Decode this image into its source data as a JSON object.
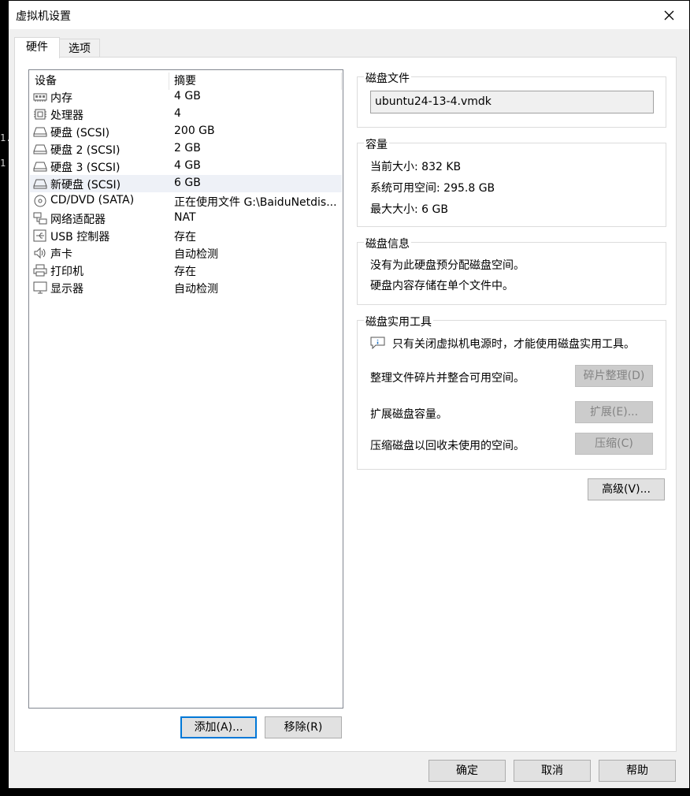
{
  "window": {
    "title": "虚拟机设置"
  },
  "tabs": [
    {
      "label": "硬件"
    },
    {
      "label": "选项"
    }
  ],
  "background_fragments": [
    "1.",
    "1"
  ],
  "device_list": {
    "columns": {
      "device": "设备",
      "summary": "摘要"
    },
    "rows": [
      {
        "icon": "memory-icon",
        "name": "内存",
        "summary": "4 GB"
      },
      {
        "icon": "cpu-icon",
        "name": "处理器",
        "summary": "4"
      },
      {
        "icon": "harddisk-icon",
        "name": "硬盘 (SCSI)",
        "summary": "200 GB"
      },
      {
        "icon": "harddisk-icon",
        "name": "硬盘 2 (SCSI)",
        "summary": "2 GB"
      },
      {
        "icon": "harddisk-icon",
        "name": "硬盘 3 (SCSI)",
        "summary": "4 GB"
      },
      {
        "icon": "harddisk-icon",
        "name": "新硬盘 (SCSI)",
        "summary": "6 GB",
        "selected": true
      },
      {
        "icon": "cd-icon",
        "name": "CD/DVD (SATA)",
        "summary": "正在使用文件 G:\\BaiduNetdis..."
      },
      {
        "icon": "network-icon",
        "name": "网络适配器",
        "summary": "NAT"
      },
      {
        "icon": "usb-icon",
        "name": "USB 控制器",
        "summary": "存在"
      },
      {
        "icon": "speaker-icon",
        "name": "声卡",
        "summary": "自动检测"
      },
      {
        "icon": "printer-icon",
        "name": "打印机",
        "summary": "存在"
      },
      {
        "icon": "monitor-icon",
        "name": "显示器",
        "summary": "自动检测"
      }
    ],
    "add_button": "添加(A)...",
    "remove_button": "移除(R)"
  },
  "disk_file": {
    "title": "磁盘文件",
    "value": "ubuntu24-13-4.vmdk"
  },
  "capacity": {
    "title": "容量",
    "current_size": "当前大小: 832 KB",
    "system_free": "系统可用空间: 295.8 GB",
    "max_size": "最大大小: 6 GB"
  },
  "disk_info": {
    "title": "磁盘信息",
    "line1": "没有为此硬盘预分配磁盘空间。",
    "line2": "硬盘内容存储在单个文件中。"
  },
  "disk_utilities": {
    "title": "磁盘实用工具",
    "notice": "只有关闭虚拟机电源时，才能使用磁盘实用工具。",
    "defrag_text": "整理文件碎片并整合可用空间。",
    "defrag_button": "碎片整理(D)",
    "expand_text": "扩展磁盘容量。",
    "expand_button": "扩展(E)...",
    "compact_text": "压缩磁盘以回收未使用的空间。",
    "compact_button": "压缩(C)"
  },
  "advanced_button": "高级(V)...",
  "footer": {
    "ok": "确定",
    "cancel": "取消",
    "help": "帮助"
  }
}
